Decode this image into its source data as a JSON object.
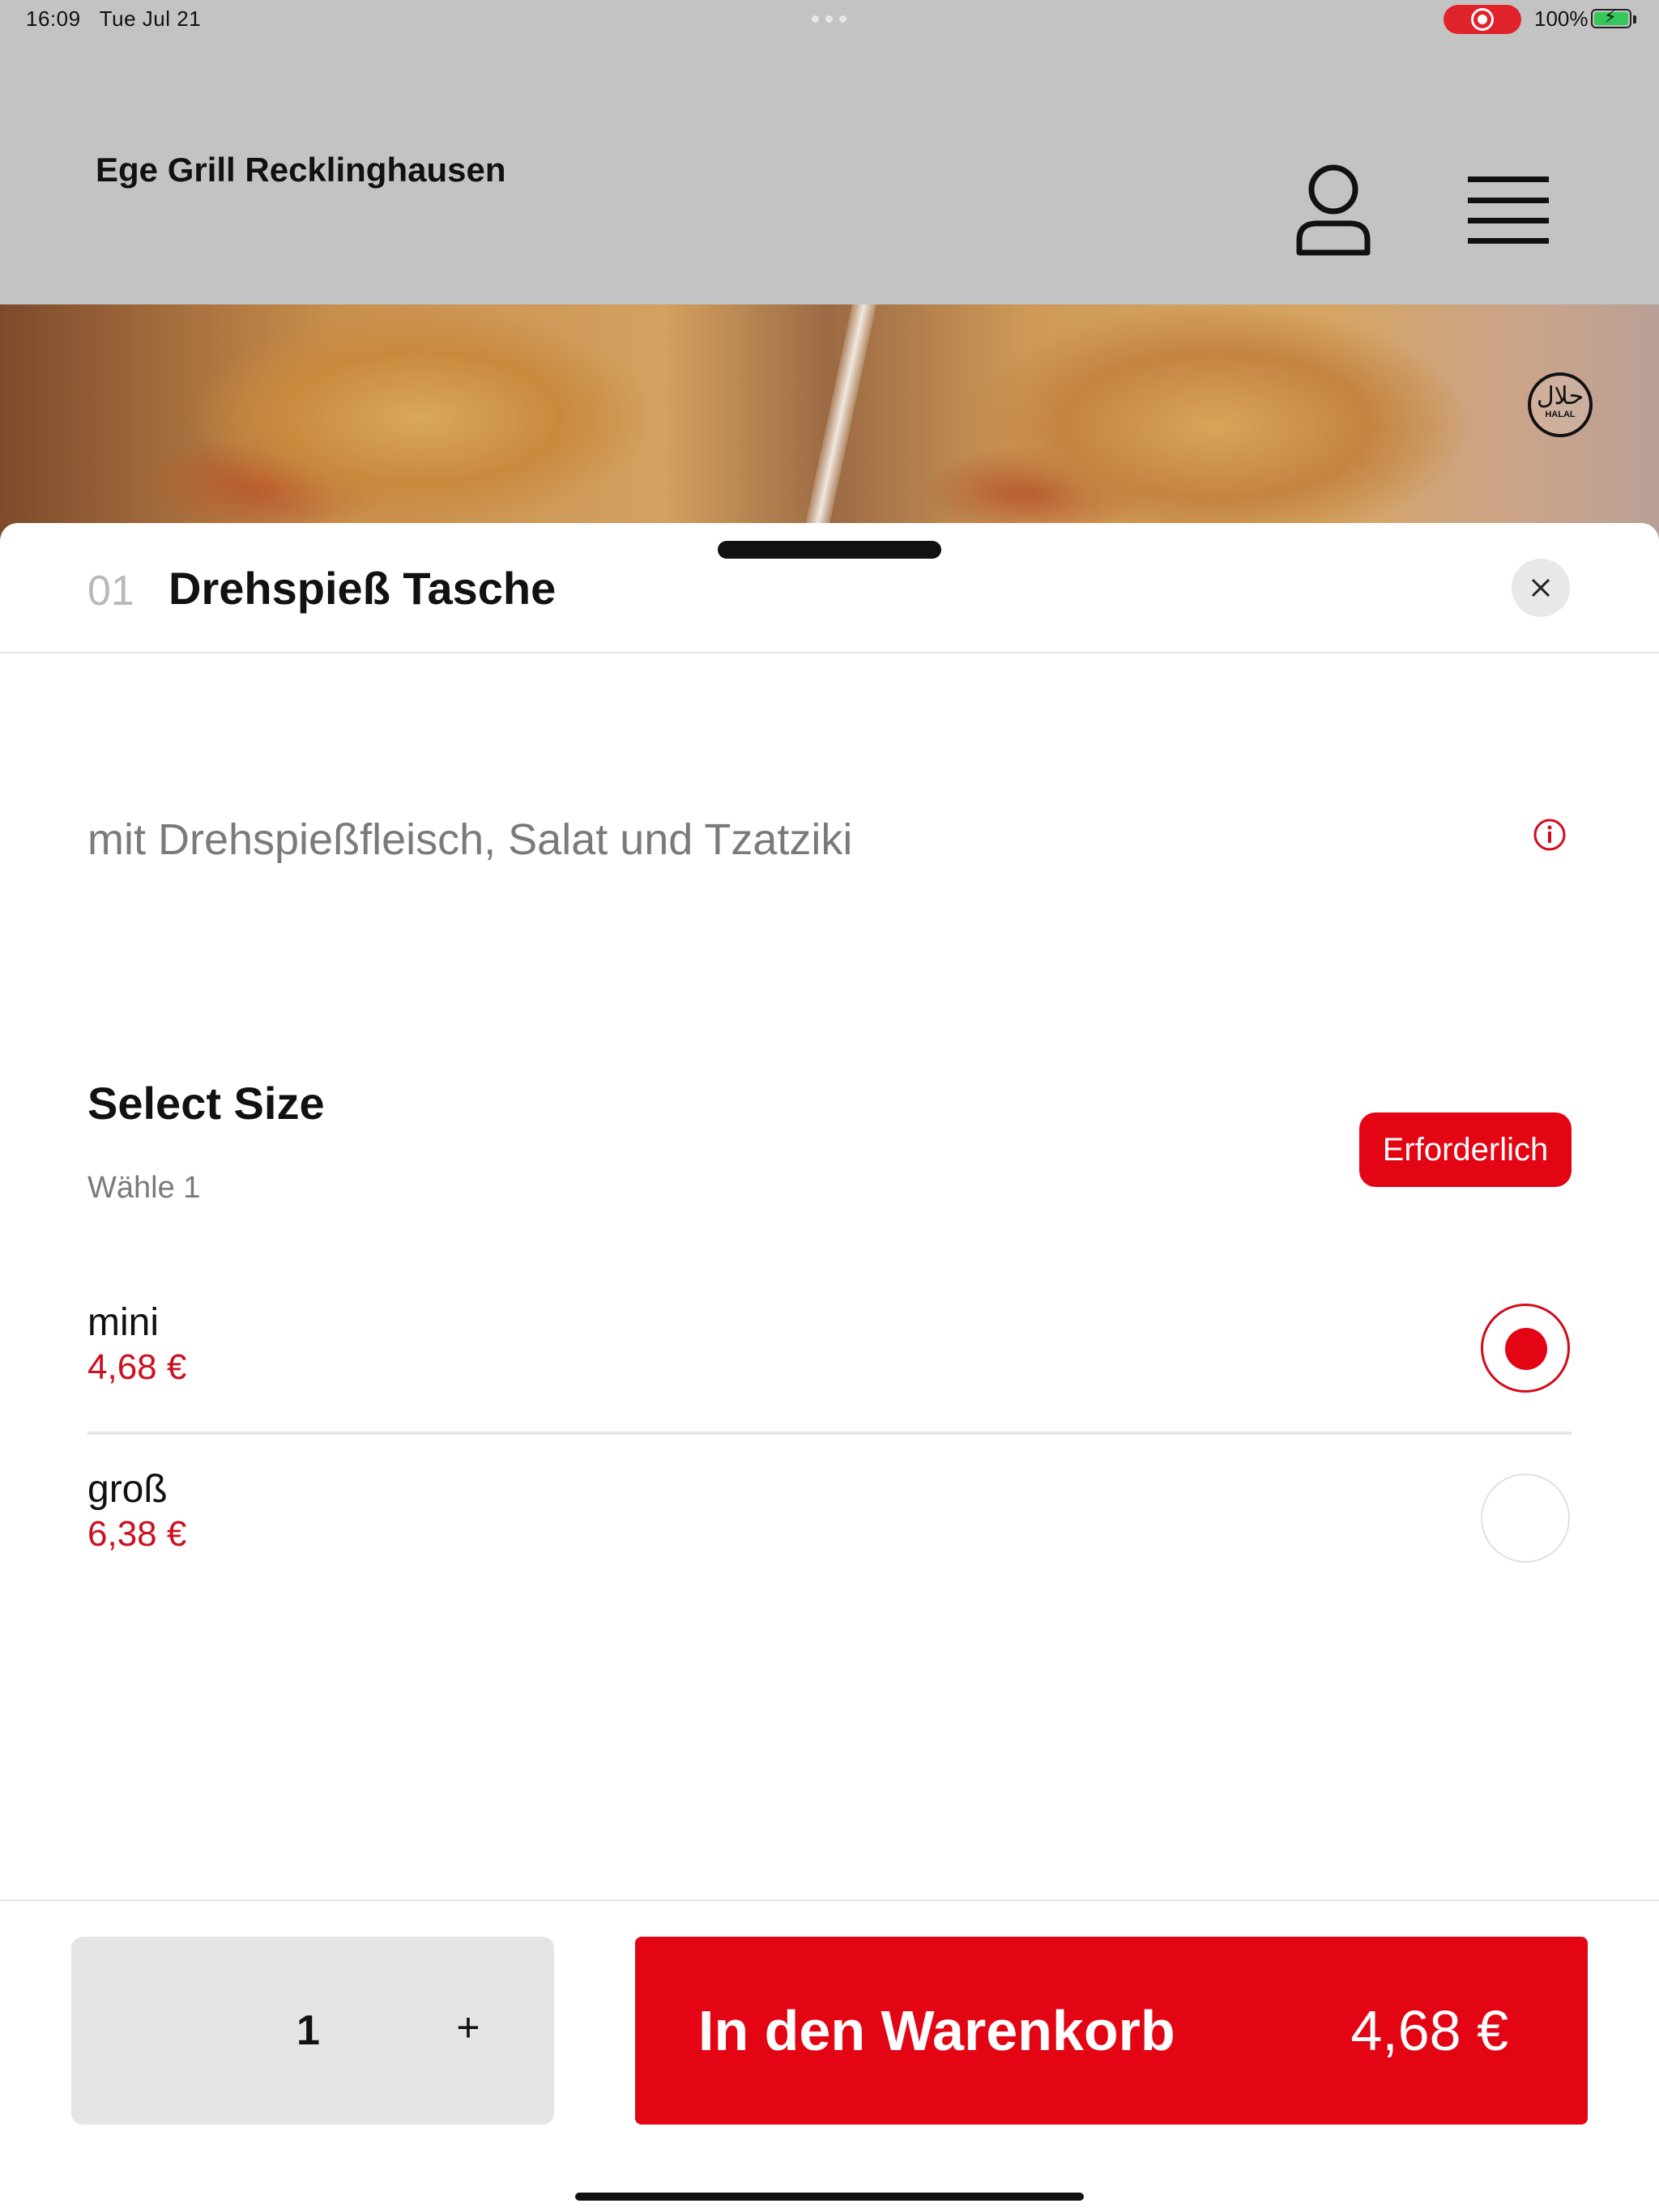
{
  "status_bar": {
    "time": "16:09",
    "date": "Tue Jul 21",
    "battery": "100%"
  },
  "header": {
    "restaurant_name": "Ege Grill Recklinghausen",
    "halal_badge_arabic": "حلال",
    "halal_badge_text": "HALAL"
  },
  "item": {
    "number": "01",
    "title": "Drehspieß Tasche",
    "description": "mit Drehspießfleisch, Salat und Tzatziki"
  },
  "size_section": {
    "title": "Select Size",
    "subtitle": "Wähle 1",
    "required_label": "Erforderlich",
    "options": [
      {
        "name": "mini",
        "price": "4,68 €",
        "selected": true
      },
      {
        "name": "groß",
        "price": "6,38 €",
        "selected": false
      }
    ]
  },
  "footer": {
    "quantity": "1",
    "plus_label": "+",
    "add_to_cart_label": "In den Warenkorb",
    "total_price": "4,68 €"
  },
  "colors": {
    "accent": "#e30513",
    "price": "#cc1020",
    "header_bg": "#c3c3c3"
  },
  "icons": [
    "user-icon",
    "hamburger-menu-icon",
    "close-icon",
    "info-icon",
    "halal-icon",
    "plus-icon"
  ]
}
